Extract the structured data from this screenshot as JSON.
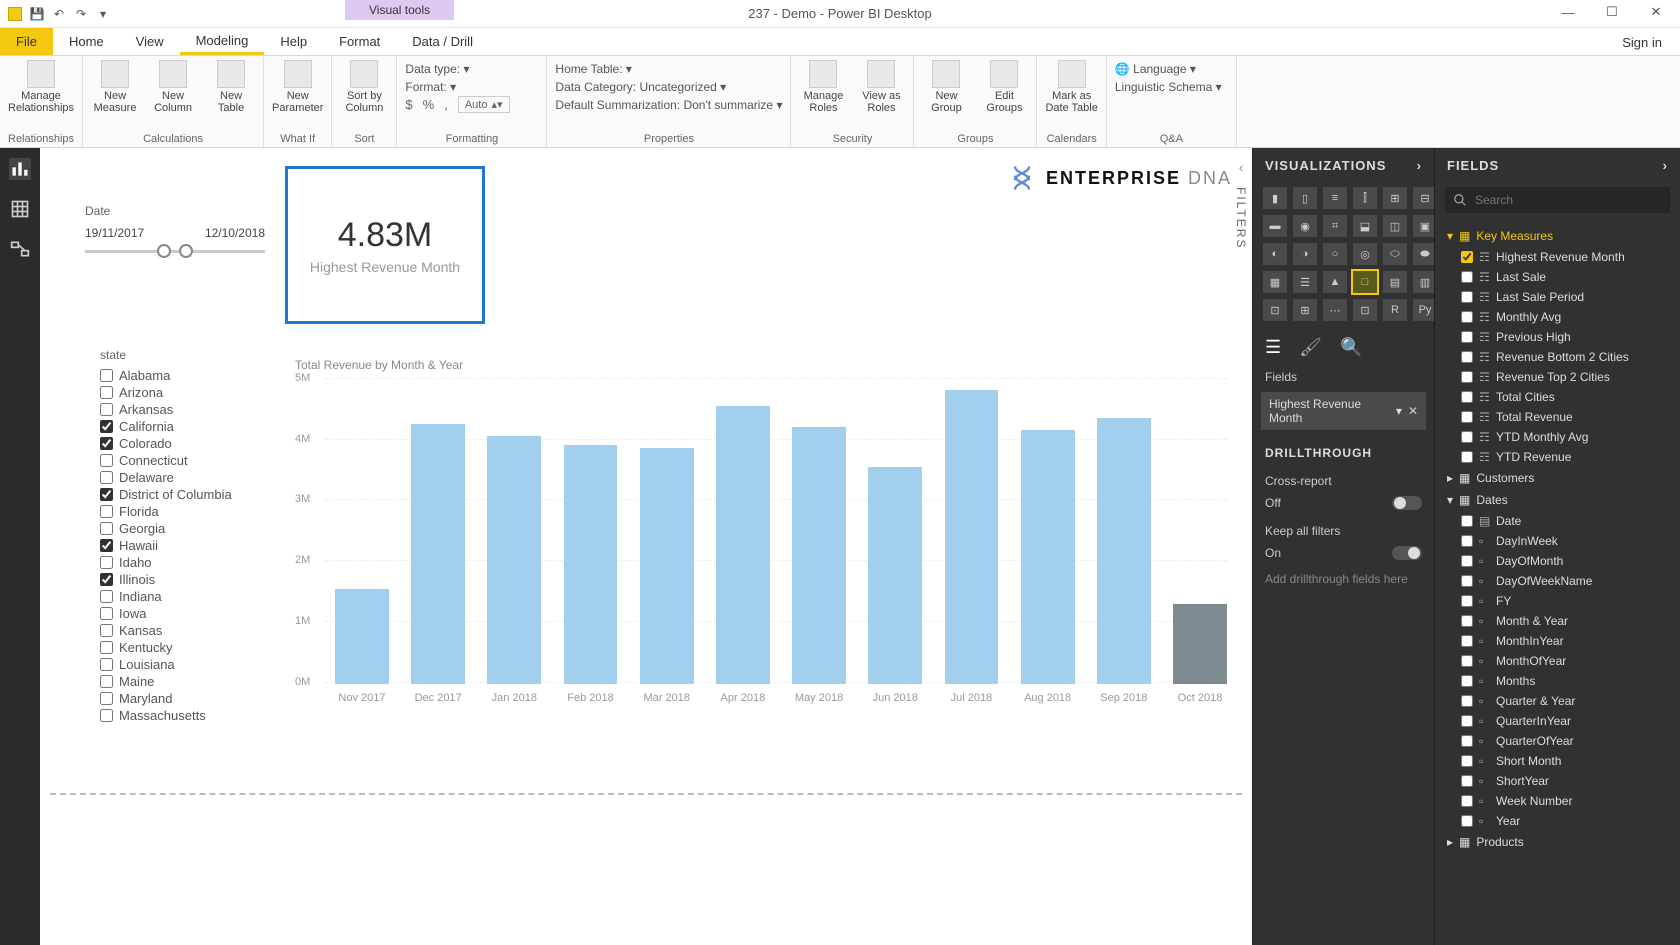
{
  "window": {
    "title": "237 - Demo - Power BI Desktop",
    "visual_tools": "Visual tools",
    "sign_in": "Sign in"
  },
  "tabs": {
    "file": "File",
    "home": "Home",
    "view": "View",
    "modeling": "Modeling",
    "help": "Help",
    "format": "Format",
    "data_drill": "Data / Drill"
  },
  "ribbon": {
    "relationships": {
      "manage": "Manage\nRelationships",
      "group": "Relationships"
    },
    "calc": {
      "measure": "New\nMeasure",
      "column": "New\nColumn",
      "table": "New\nTable",
      "group": "Calculations"
    },
    "whatif": {
      "param": "New\nParameter",
      "group": "What If"
    },
    "sort": {
      "sortby": "Sort by\nColumn",
      "group": "Sort"
    },
    "formatting": {
      "datatype": "Data type: ",
      "format": "Format: ",
      "dollar": "$",
      "percent": "%",
      "comma": ",",
      "auto": "Auto",
      "group": "Formatting"
    },
    "properties": {
      "hometable": "Home Table: ",
      "datacat": "Data Category: Uncategorized",
      "summ": "Default Summarization: Don't summarize",
      "group": "Properties"
    },
    "security": {
      "manage": "Manage\nRoles",
      "view": "View as\nRoles",
      "group": "Security"
    },
    "groups": {
      "new": "New\nGroup",
      "edit": "Edit\nGroups",
      "group": "Groups"
    },
    "calendars": {
      "mark": "Mark as\nDate Table",
      "group": "Calendars"
    },
    "qa": {
      "lang": "Language",
      "ling": "Linguistic Schema",
      "group": "Q&A"
    }
  },
  "slicers": {
    "date": {
      "label": "Date",
      "from": "19/11/2017",
      "to": "12/10/2018"
    },
    "state": {
      "label": "state",
      "items": [
        {
          "name": "Alabama",
          "checked": false
        },
        {
          "name": "Arizona",
          "checked": false
        },
        {
          "name": "Arkansas",
          "checked": false
        },
        {
          "name": "California",
          "checked": true
        },
        {
          "name": "Colorado",
          "checked": true
        },
        {
          "name": "Connecticut",
          "checked": false
        },
        {
          "name": "Delaware",
          "checked": false
        },
        {
          "name": "District of Columbia",
          "checked": true
        },
        {
          "name": "Florida",
          "checked": false
        },
        {
          "name": "Georgia",
          "checked": false
        },
        {
          "name": "Hawaii",
          "checked": true
        },
        {
          "name": "Idaho",
          "checked": false
        },
        {
          "name": "Illinois",
          "checked": true
        },
        {
          "name": "Indiana",
          "checked": false
        },
        {
          "name": "Iowa",
          "checked": false
        },
        {
          "name": "Kansas",
          "checked": false
        },
        {
          "name": "Kentucky",
          "checked": false
        },
        {
          "name": "Louisiana",
          "checked": false
        },
        {
          "name": "Maine",
          "checked": false
        },
        {
          "name": "Maryland",
          "checked": false
        },
        {
          "name": "Massachusetts",
          "checked": false
        }
      ]
    }
  },
  "card": {
    "value": "4.83M",
    "label": "Highest Revenue Month"
  },
  "logo": {
    "brand1": "ENTERPRISE",
    "brand2": "DNA"
  },
  "filters_label": "FILTERS",
  "viz_pane": {
    "title": "VISUALIZATIONS",
    "fields_label": "Fields",
    "field_chip": "Highest Revenue Month",
    "drill_label": "DRILLTHROUGH",
    "cross": "Cross-report",
    "cross_state": "Off",
    "keep": "Keep all filters",
    "keep_state": "On",
    "placeholder": "Add drillthrough fields here"
  },
  "fields_pane": {
    "title": "FIELDS",
    "search_placeholder": "Search",
    "tables": [
      {
        "name": "Key Measures",
        "expanded": true,
        "highlight": true,
        "fields": [
          {
            "name": "Highest Revenue Month",
            "checked": true,
            "type": "measure"
          },
          {
            "name": "Last Sale",
            "checked": false,
            "type": "measure"
          },
          {
            "name": "Last Sale Period",
            "checked": false,
            "type": "measure"
          },
          {
            "name": "Monthly Avg",
            "checked": false,
            "type": "measure"
          },
          {
            "name": "Previous High",
            "checked": false,
            "type": "measure"
          },
          {
            "name": "Revenue Bottom 2 Cities",
            "checked": false,
            "type": "measure"
          },
          {
            "name": "Revenue Top 2 Cities",
            "checked": false,
            "type": "measure"
          },
          {
            "name": "Total Cities",
            "checked": false,
            "type": "measure"
          },
          {
            "name": "Total Revenue",
            "checked": false,
            "type": "measure"
          },
          {
            "name": "YTD Monthly Avg",
            "checked": false,
            "type": "measure"
          },
          {
            "name": "YTD Revenue",
            "checked": false,
            "type": "measure"
          }
        ]
      },
      {
        "name": "Customers",
        "expanded": false,
        "highlight": false
      },
      {
        "name": "Dates",
        "expanded": true,
        "highlight": false,
        "fields": [
          {
            "name": "Date",
            "checked": false,
            "type": "hier"
          },
          {
            "name": "DayInWeek",
            "checked": false,
            "type": "col"
          },
          {
            "name": "DayOfMonth",
            "checked": false,
            "type": "col"
          },
          {
            "name": "DayOfWeekName",
            "checked": false,
            "type": "col"
          },
          {
            "name": "FY",
            "checked": false,
            "type": "col"
          },
          {
            "name": "Month & Year",
            "checked": false,
            "type": "col"
          },
          {
            "name": "MonthInYear",
            "checked": false,
            "type": "col"
          },
          {
            "name": "MonthOfYear",
            "checked": false,
            "type": "col"
          },
          {
            "name": "Months",
            "checked": false,
            "type": "col"
          },
          {
            "name": "Quarter & Year",
            "checked": false,
            "type": "col"
          },
          {
            "name": "QuarterInYear",
            "checked": false,
            "type": "col"
          },
          {
            "name": "QuarterOfYear",
            "checked": false,
            "type": "col"
          },
          {
            "name": "Short Month",
            "checked": false,
            "type": "col"
          },
          {
            "name": "ShortYear",
            "checked": false,
            "type": "col"
          },
          {
            "name": "Week Number",
            "checked": false,
            "type": "col"
          },
          {
            "name": "Year",
            "checked": false,
            "type": "col"
          }
        ]
      },
      {
        "name": "Products",
        "expanded": false,
        "highlight": false
      }
    ]
  },
  "chart_data": {
    "type": "bar",
    "title": "Total Revenue by Month & Year",
    "ylabel": "",
    "ylim": [
      0,
      5
    ],
    "yticks": [
      "0M",
      "1M",
      "2M",
      "3M",
      "4M",
      "5M"
    ],
    "categories": [
      "Nov 2017",
      "Dec 2017",
      "Jan 2018",
      "Feb 2018",
      "Mar 2018",
      "Apr 2018",
      "May 2018",
      "Jun 2018",
      "Jul 2018",
      "Aug 2018",
      "Sep 2018",
      "Oct 2018"
    ],
    "values": [
      1.55,
      4.25,
      4.05,
      3.9,
      3.85,
      4.55,
      4.2,
      3.55,
      4.8,
      4.15,
      4.35,
      1.3
    ],
    "highlight_last": true
  }
}
